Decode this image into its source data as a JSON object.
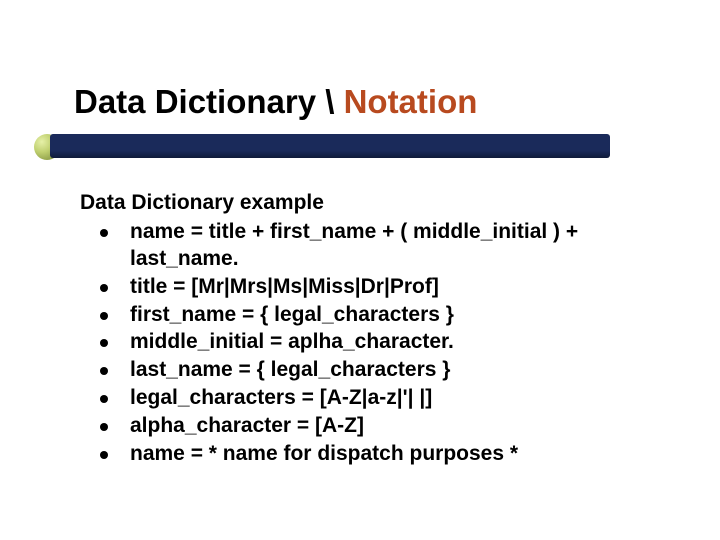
{
  "title_prefix": "Data Dictionary \\ ",
  "title_accent": "Notation",
  "subhead": "Data Dictionary example",
  "items": [
    "name = title + first_name + ( middle_initial ) + last_name.",
    "title = [Mr|Mrs|Ms|Miss|Dr|Prof]",
    "first_name = { legal_characters }",
    "middle_initial = aplha_character.",
    "last_name = { legal_characters }",
    "legal_characters = [A-Z|a-z|'| |]",
    "alpha_character = [A-Z]",
    "name = * name for dispatch purposes *"
  ]
}
